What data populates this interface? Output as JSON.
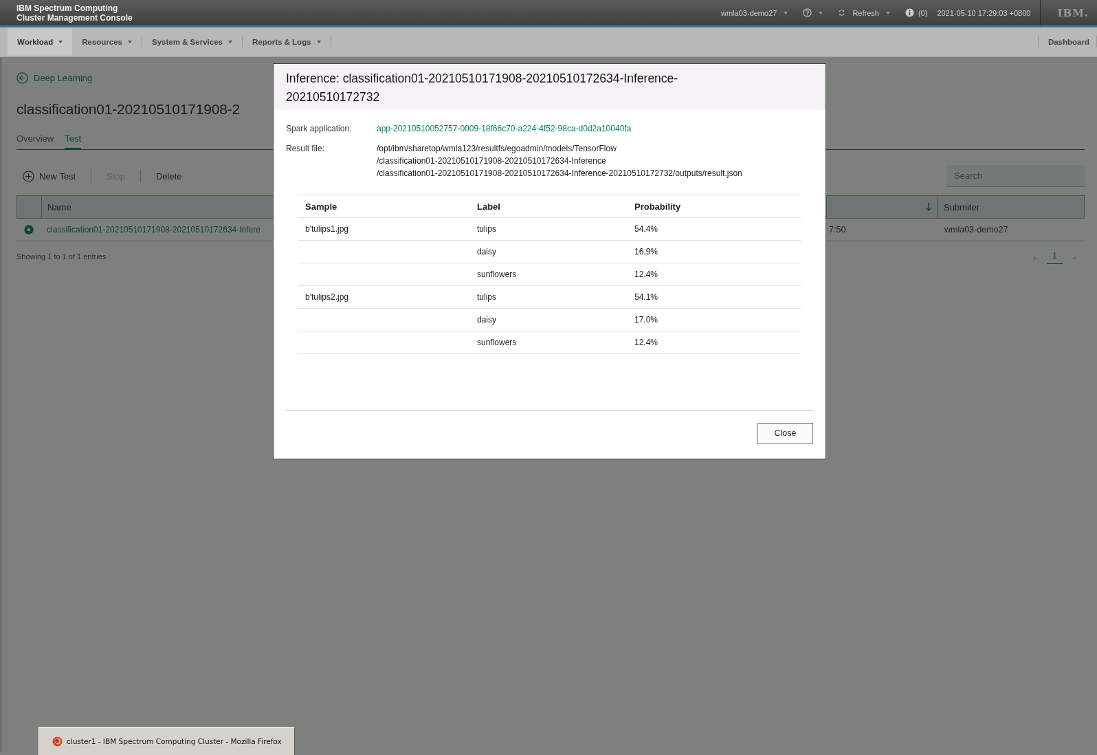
{
  "header": {
    "product_lines": [
      "IBM Spectrum Computing",
      "Cluster Management Console"
    ],
    "user": "wmla03-demo27",
    "refresh": "Refresh",
    "notifications": "(0)",
    "datetime": "2021-05-10 17:29:03 +0800",
    "logo": "IBM."
  },
  "nav": {
    "items": [
      {
        "label": "Workload",
        "selected": true
      },
      {
        "label": "Resources",
        "selected": false
      },
      {
        "label": "System & Services",
        "selected": false
      },
      {
        "label": "Reports & Logs",
        "selected": false
      }
    ],
    "right_item": "Dashboard"
  },
  "page": {
    "back_link": "Deep Learning",
    "title": "classification01-20210510171908-2",
    "tabs": [
      {
        "label": "Overview",
        "selected": false
      },
      {
        "label": "Test",
        "selected": true
      }
    ],
    "toolbar": [
      {
        "kind": "add",
        "label": "New Test",
        "disabled": false
      },
      {
        "kind": "plain",
        "label": "Stop",
        "disabled": true
      },
      {
        "kind": "plain",
        "label": "Delete",
        "disabled": false
      }
    ],
    "search": {
      "placeholder": "Search"
    },
    "table": {
      "name_column": "Name",
      "submitter_column": "Submiter",
      "rows": [
        {
          "selected": true,
          "name": "classification01-20210510171908-20210510172634-Infere",
          "time": "7:50",
          "submitter": "wmla03-demo27"
        }
      ]
    },
    "footer": "Showing 1 to 1 of 1 entries",
    "pagination": {
      "prev": "←",
      "page": "1",
      "next": "→"
    }
  },
  "dialog": {
    "title": "Inference: classification01-20210510171908-20210510172634-Inference-20210510172732",
    "fields": [
      {
        "label": "Spark application:",
        "kind": "link",
        "lines": [
          "app-20210510052757-0009-18f66c70-a224-4f52-98ca-d0d2a10040fa"
        ]
      },
      {
        "label": "Result file:",
        "kind": "text",
        "lines": [
          "/opt/ibm/sharetop/wmla123/resultfs/egoadmin/models/TensorFlow",
          "/classification01-20210510171908-20210510172634-Inference",
          "/classification01-20210510171908-20210510172634-Inference-20210510172732/outputs/result.json"
        ]
      }
    ],
    "columns": [
      "Sample",
      "Label",
      "Probability"
    ],
    "rows": [
      {
        "sample": "b'tulips1.jpg",
        "label": "tulips",
        "probability": "54.4%"
      },
      {
        "label": "daisy",
        "probability": "16.9%"
      },
      {
        "label": "sunflowers",
        "probability": "12.4%"
      },
      {
        "sample": "b'tulips2.jpg",
        "label": "tulips",
        "probability": "54.1%"
      },
      {
        "label": "daisy",
        "probability": "17.0%"
      },
      {
        "label": "sunflowers",
        "probability": "12.4%"
      }
    ],
    "close": "Close"
  },
  "taskbar": {
    "window_title": "cluster1 - IBM Spectrum Computing Cluster - Mozilla Firefox"
  }
}
